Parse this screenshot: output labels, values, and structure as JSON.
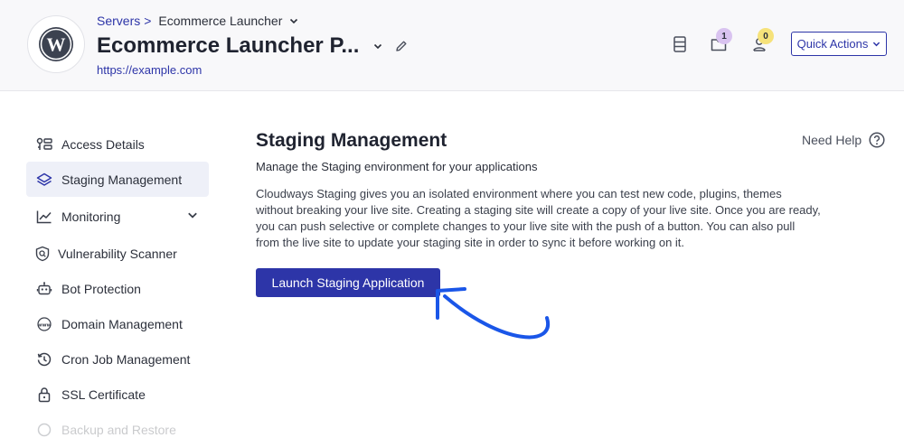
{
  "header": {
    "breadcrumb": {
      "parent": "Servers",
      "separator": ">",
      "current": "Ecommerce Launcher"
    },
    "app_title": "Ecommerce Launcher P...",
    "app_url": "https://example.com",
    "notifications": {
      "folder_count": "1",
      "user_count": "0"
    },
    "quick_actions_label": "Quick Actions"
  },
  "sidebar": {
    "items": [
      {
        "label": "Access Details",
        "icon": "access-details-icon"
      },
      {
        "label": "Staging Management",
        "icon": "layers-icon",
        "active": true
      },
      {
        "label": "Monitoring",
        "icon": "chart-line-icon",
        "expandable": true
      },
      {
        "label": "Vulnerability Scanner",
        "icon": "shield-scan-icon"
      },
      {
        "label": "Bot Protection",
        "icon": "robot-icon"
      },
      {
        "label": "Domain Management",
        "icon": "www-icon"
      },
      {
        "label": "Cron Job Management",
        "icon": "history-icon"
      },
      {
        "label": "SSL Certificate",
        "icon": "lock-icon"
      },
      {
        "label": "Backup and Restore",
        "icon": "backup-icon"
      }
    ]
  },
  "main": {
    "title": "Staging Management",
    "need_help": "Need Help",
    "subtitle": "Manage the Staging environment for your applications",
    "description": "Cloudways Staging gives you an isolated environment where you can test new code, plugins, themes without breaking your live site. Creating a staging site will create a copy of your live site. Once you are ready, you can push selective or complete changes to your live site with the push of a button. You can also pull from the live site to update your staging site in order to sync it before working on it.",
    "launch_button": "Launch Staging Application"
  },
  "colors": {
    "primary": "#2d35a8",
    "active_bg": "#eef0f8",
    "badge_purple": "#d9c3f0",
    "badge_yellow": "#f6e27a",
    "annotation_arrow": "#1a56e8"
  }
}
